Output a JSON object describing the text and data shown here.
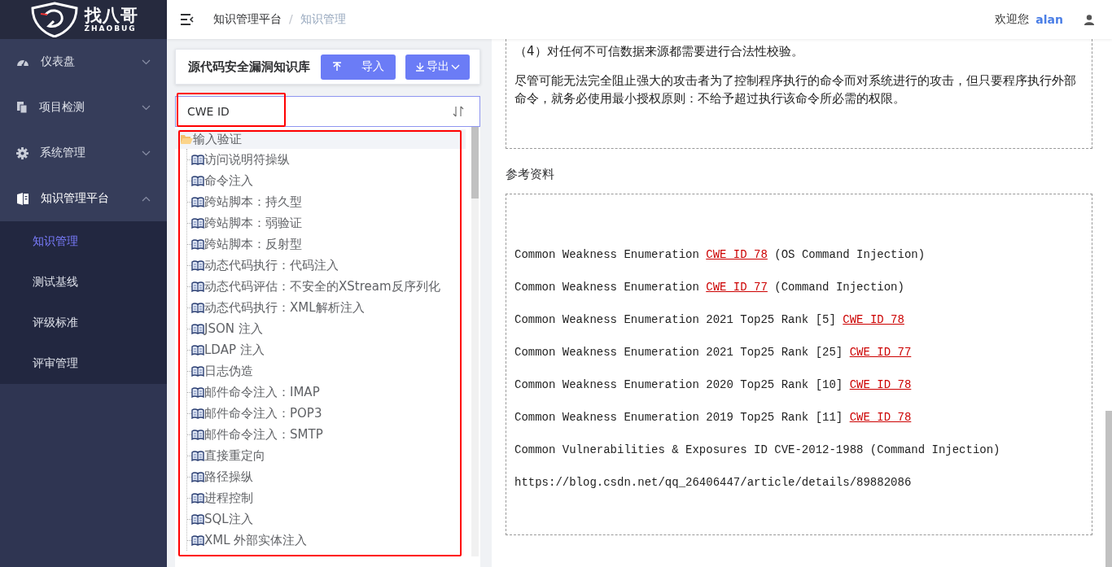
{
  "logo": {
    "name": "找八哥",
    "subtitle": "ZHAOBUG"
  },
  "sidebar": {
    "items": [
      {
        "label": "仪表盘",
        "expanded": false
      },
      {
        "label": "项目检测",
        "expanded": false
      },
      {
        "label": "系统管理",
        "expanded": false
      },
      {
        "label": "知识管理平台",
        "expanded": true,
        "children": [
          {
            "label": "知识管理",
            "selected": true
          },
          {
            "label": "测试基线",
            "selected": false
          },
          {
            "label": "评级标准",
            "selected": false
          },
          {
            "label": "评审管理",
            "selected": false
          }
        ]
      }
    ]
  },
  "header": {
    "breadcrumb": [
      "知识管理平台",
      "知识管理"
    ],
    "breadcrumb_separator": "/",
    "greeting": "欢迎您",
    "user": "alan"
  },
  "library": {
    "title": "源代码安全漏洞知识库",
    "buttons": [
      {
        "label": "导入",
        "kind": "upload"
      },
      {
        "label": "导出",
        "kind": "download-menu"
      }
    ],
    "search": {
      "value": "CWE ID",
      "highlighted": true
    },
    "tree_highlighted": true,
    "tree": [
      {
        "label": "输入验证",
        "expanded": true,
        "children": [
          {
            "label": "访问说明符操纵"
          },
          {
            "label": "命令注入"
          },
          {
            "label": "跨站脚本：持久型"
          },
          {
            "label": "跨站脚本：弱验证"
          },
          {
            "label": "跨站脚本：反射型"
          },
          {
            "label": "动态代码执行：代码注入"
          },
          {
            "label": "动态代码评估：不安全的XStream反序列化"
          },
          {
            "label": "动态代码执行：XML解析注入"
          },
          {
            "label": "JSON 注入"
          },
          {
            "label": "LDAP 注入"
          },
          {
            "label": "日志伪造"
          },
          {
            "label": "邮件命令注入：IMAP"
          },
          {
            "label": "邮件命令注入：POP3"
          },
          {
            "label": "邮件命令注入：SMTP"
          },
          {
            "label": "直接重定向"
          },
          {
            "label": "路径操纵"
          },
          {
            "label": "进程控制"
          },
          {
            "label": "SQL注入"
          },
          {
            "label": "XML 外部实体注入"
          }
        ]
      }
    ]
  },
  "document": {
    "paragraphs": [
      "（4）对任何不可信数据来源都需要进行合法性校验。",
      "尽管可能无法完全阻止强大的攻击者为了控制程序执行的命令而对系统进行的攻击，但只要程序执行外部命令，就务必使用最小授权原则：不给予超过执行该命令所必需的权限。"
    ],
    "references_title": "参考资料",
    "references": [
      {
        "text": "Common Weakness Enumeration",
        "link": "CWE ID 78",
        "suffix": "(OS Command Injection)"
      },
      {
        "text": "Common Weakness Enumeration",
        "link": "CWE ID 77",
        "suffix": "(Command Injection)"
      },
      {
        "text": "Common Weakness Enumeration 2021 Top25 Rank [5]",
        "link": "CWE ID 78"
      },
      {
        "text": "Common Weakness Enumeration 2021 Top25 Rank [25]",
        "link": "CWE ID 77"
      },
      {
        "text": "Common Weakness Enumeration 2020 Top25 Rank [10]",
        "link": "CWE ID 78"
      },
      {
        "text": "Common Weakness Enumeration 2019 Top25 Rank [11]",
        "link": "CWE ID 78"
      },
      {
        "text": "Common Vulnerabilities & Exposures ID CVE-2012-1988 (Command Injection)"
      },
      {
        "text": "https://blog.csdn.net/qq_26406447/article/details/89882086"
      }
    ]
  }
}
